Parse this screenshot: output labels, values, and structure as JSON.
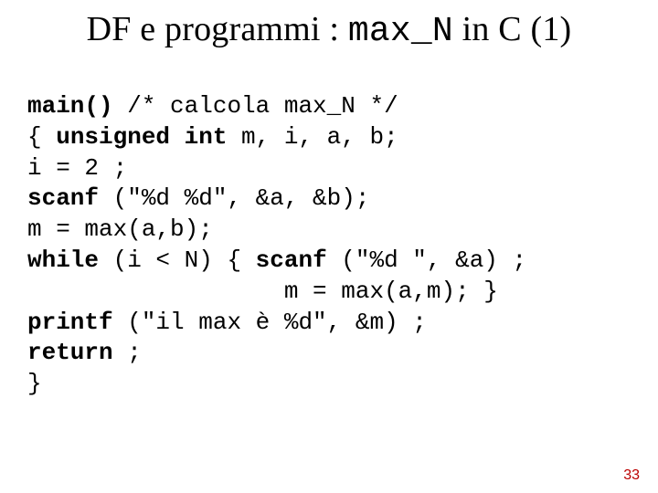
{
  "title": {
    "pre": "DF e programmi : ",
    "mono": "max_N",
    "post": " in C (1)"
  },
  "code": {
    "l1a": "main()",
    "l1b": " /* calcola max_N */",
    "l2a": "{ ",
    "l2b": "unsigned int",
    "l2c": " m, i, a, b;",
    "l3": "i = 2 ;",
    "l4a": "scanf",
    "l4b": " (\"%d %d\", &a, &b);",
    "l5": "m = max(a,b);",
    "l6a": "while",
    "l6b": " (i < N) { ",
    "l6c": "scanf",
    "l6d": " (\"%d \", &a) ;",
    "l7": "                  m = max(a,m); }",
    "l8a": "printf",
    "l8b": " (\"il max è %d\", &m) ;",
    "l9a": "return",
    "l9b": " ;",
    "l10": "}"
  },
  "page": "33"
}
